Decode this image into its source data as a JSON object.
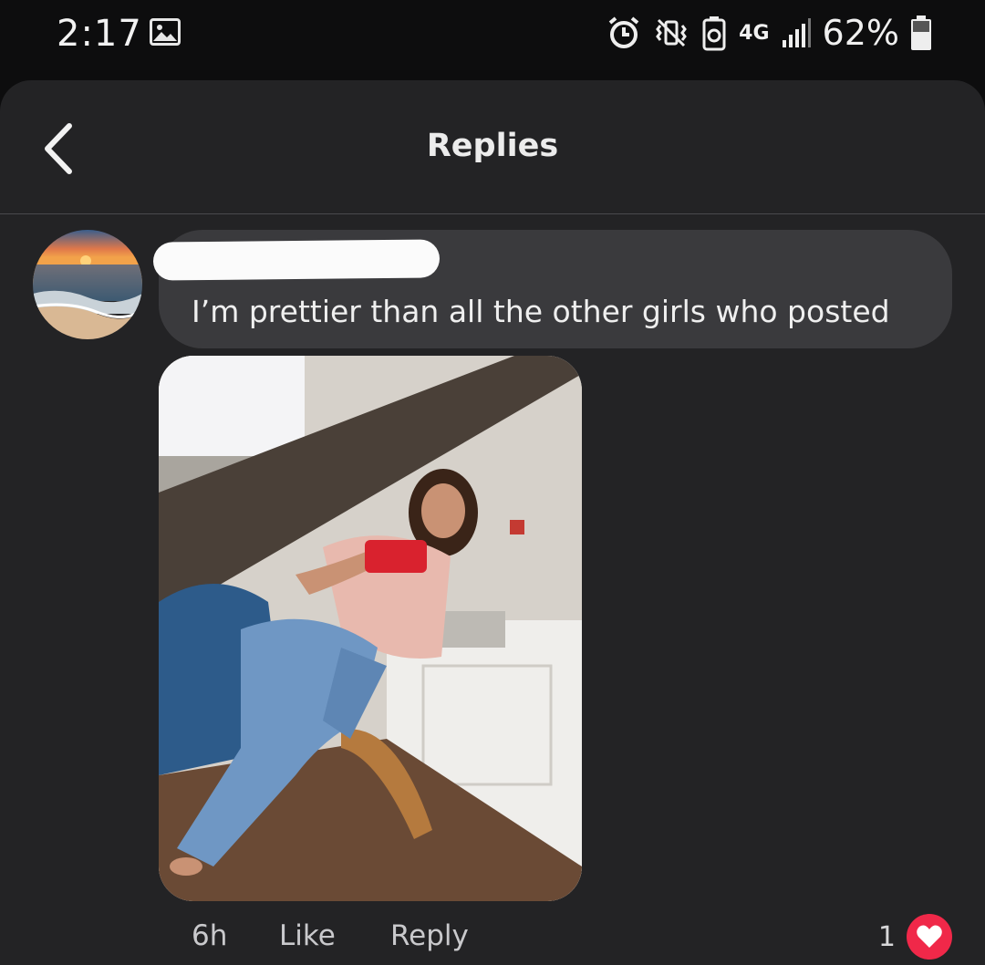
{
  "status_bar": {
    "time": "2:17",
    "network_label": "4G",
    "battery_percent": "62%",
    "icons": [
      "image-icon",
      "alarm-icon",
      "vibrate-icon",
      "battery-saver-icon",
      "signal-icon",
      "battery-icon"
    ]
  },
  "header": {
    "title": "Replies",
    "back_icon": "chevron-left-icon"
  },
  "comment": {
    "author_redacted": true,
    "text": "I’m prettier than all the other girls who posted",
    "time": "6h",
    "like_label": "Like",
    "reply_label": "Reply",
    "reaction_count": "1",
    "reaction_icon": "heart-icon"
  },
  "colors": {
    "background": "#0d0d0e",
    "panel": "#232325",
    "bubble": "#3a3a3d",
    "reaction": "#f02849"
  }
}
